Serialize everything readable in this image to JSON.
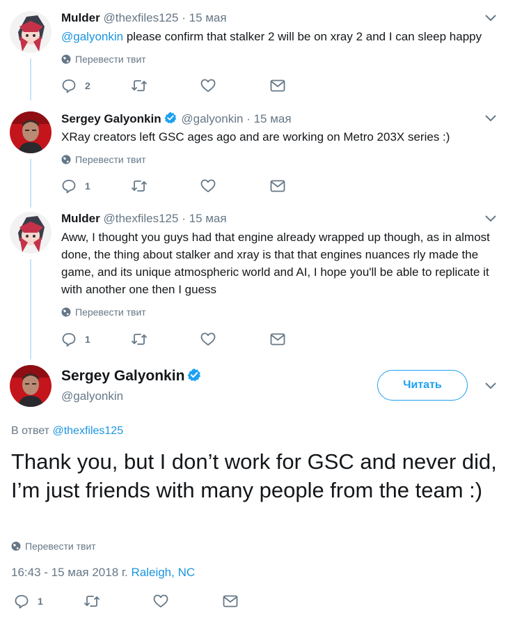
{
  "translate_label": "Перевести твит",
  "tweets": [
    {
      "name": "Mulder",
      "handle": "@thexfiles125",
      "separator": "·",
      "date": "15 мая",
      "mention": "@galyonkin",
      "text": " please confirm that stalker 2 will be on xray 2 and I can sleep happy",
      "replies": "2"
    },
    {
      "name": "Sergey Galyonkin",
      "handle": "@galyonkin",
      "separator": "·",
      "date": "15 мая",
      "text": "XRay creators left GSC ages ago and are working on Metro 203X series :)",
      "replies": "1"
    },
    {
      "name": "Mulder",
      "handle": "@thexfiles125",
      "separator": "·",
      "date": "15 мая",
      "text": "Aww, I thought you guys had that engine already wrapped up though, as in almost done, the thing about stalker and xray is that that engines nuances rly made the game, and its unique atmospheric world and AI, I hope you'll be able to replicate it with another one then I guess",
      "replies": "1"
    }
  ],
  "main": {
    "name": "Sergey Galyonkin",
    "handle": "@galyonkin",
    "follow_label": "Читать",
    "reply_prefix": "В ответ ",
    "reply_to": "@thexfiles125",
    "text": "Thank you, but I don’t work for GSC and never did, I’m just friends with many people from the team :)",
    "timestamp": "16:43 - 15 мая 2018 г.",
    "location": "Raleigh, NC",
    "replies": "1"
  },
  "icons": {
    "reply": "reply-icon",
    "retweet": "retweet-icon",
    "like": "heart-icon",
    "dm": "envelope-icon",
    "more": "chevron-down-icon",
    "verified": "verified-badge-icon",
    "translate": "globe-icon"
  },
  "colors": {
    "accent": "#1da1f2",
    "link": "#1b95e0",
    "muted": "#657786",
    "text": "#14171a",
    "thread_line": "#c6e4f5"
  }
}
